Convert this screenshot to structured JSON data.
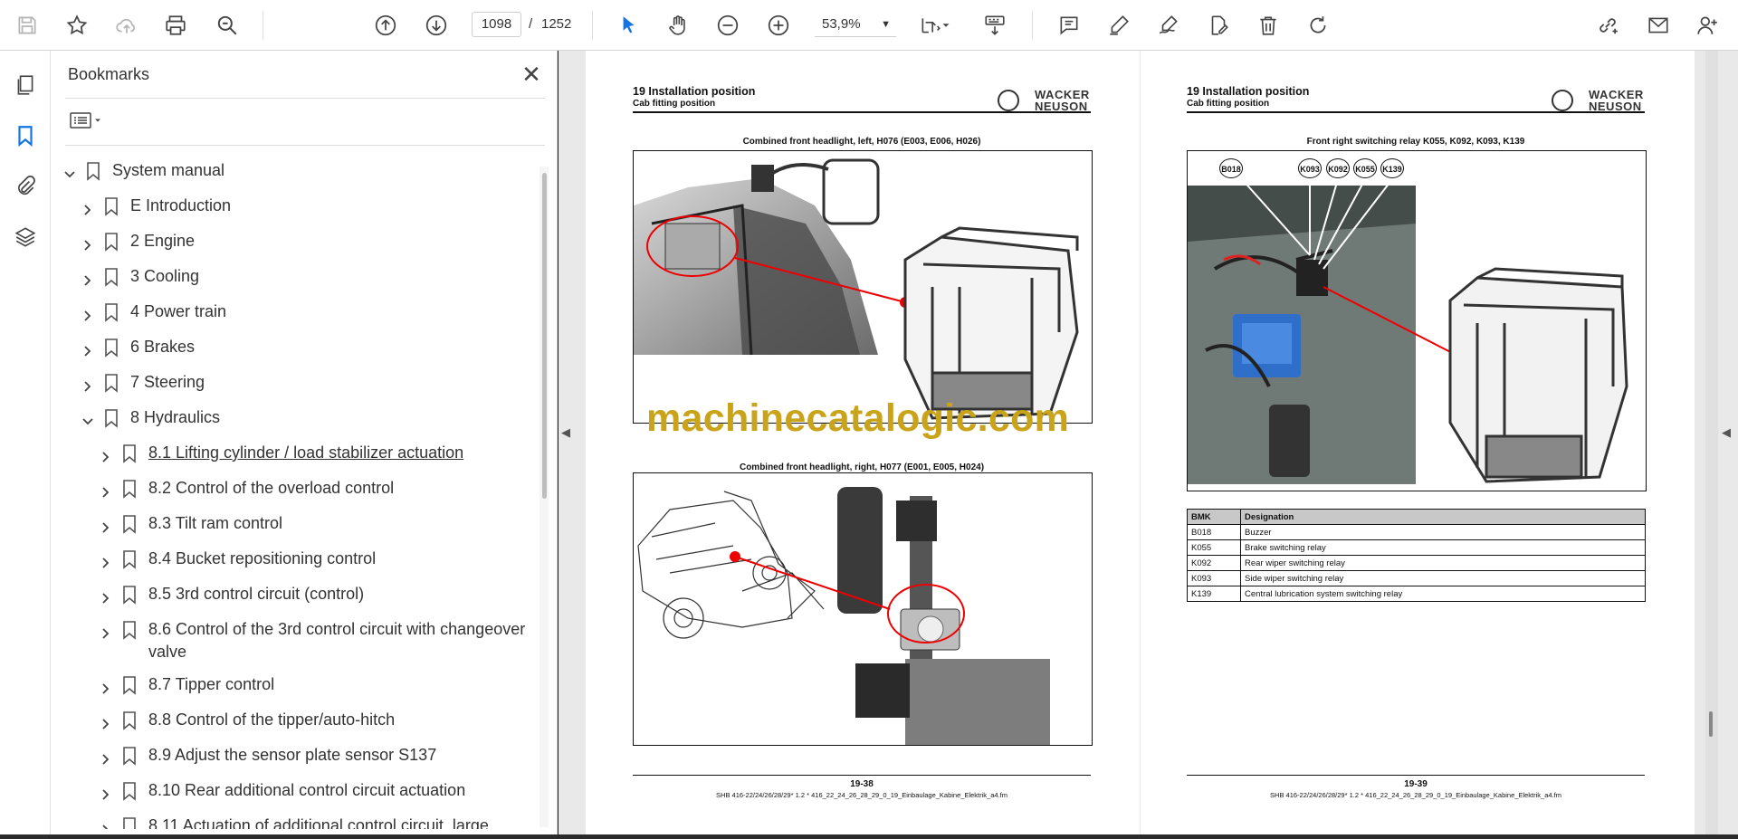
{
  "toolbar": {
    "current_page": "1098",
    "separator": "/",
    "total_pages": "1252",
    "zoom": "53,9%",
    "accent": "#1473e6"
  },
  "bookmarks_panel": {
    "title": "Bookmarks",
    "items": [
      {
        "label": "System manual",
        "level": 0,
        "expanded": true
      },
      {
        "label": "E Introduction",
        "level": 1,
        "expanded": false
      },
      {
        "label": "2 Engine",
        "level": 1,
        "expanded": false
      },
      {
        "label": "3 Cooling",
        "level": 1,
        "expanded": false
      },
      {
        "label": "4 Power train",
        "level": 1,
        "expanded": false
      },
      {
        "label": "6 Brakes",
        "level": 1,
        "expanded": false
      },
      {
        "label": "7 Steering",
        "level": 1,
        "expanded": false
      },
      {
        "label": "8 Hydraulics",
        "level": 1,
        "expanded": true
      },
      {
        "label": "8.1 Lifting cylinder / load stabilizer actuation",
        "level": 2,
        "expanded": false
      },
      {
        "label": "8.2 Control of the overload control",
        "level": 2,
        "expanded": false
      },
      {
        "label": "8.3 Tilt ram control",
        "level": 2,
        "expanded": false
      },
      {
        "label": "8.4 Bucket repositioning control",
        "level": 2,
        "expanded": false
      },
      {
        "label": "8.5 3rd control circuit (control)",
        "level": 2,
        "expanded": false
      },
      {
        "label": "8.6 Control of the 3rd control circuit with changeover",
        "label2": "valve",
        "level": 2,
        "expanded": false
      },
      {
        "label": "8.7 Tipper control",
        "level": 2,
        "expanded": false
      },
      {
        "label": "8.8 Control of the tipper/auto-hitch",
        "level": 2,
        "expanded": false
      },
      {
        "label": "8.9 Adjust the sensor plate sensor S137",
        "level": 2,
        "expanded": false
      },
      {
        "label": "8.10 Rear additional control circuit actuation",
        "level": 2,
        "expanded": false
      },
      {
        "label": "8.11 Actuation of additional control circuit, large,",
        "level": 2,
        "expanded": false
      }
    ]
  },
  "left_page": {
    "section": "19 Installation position",
    "subsection": "Cab fitting position",
    "brand_line1": "WACKER",
    "brand_line2": "NEUSON",
    "figure1_caption": "Combined front headlight, left, H076 (E003, E006, H026)",
    "figure2_caption": "Combined front headlight, right, H077 (E001, E005, H024)",
    "page_number": "19-38",
    "footer": "SHB 416-22/24/26/28/29* 1.2 * 416_22_24_26_28_29_0_19_Einbaulage_Kabine_Elektrik_a4.fm"
  },
  "right_page": {
    "section": "19 Installation position",
    "subsection": "Cab fitting position",
    "brand_line1": "WACKER",
    "brand_line2": "NEUSON",
    "figure_caption": "Front right switching relay K055, K092, K093, K139",
    "callouts": [
      "B018",
      "K093",
      "K092",
      "K055",
      "K139"
    ],
    "table": {
      "headers": [
        "BMK",
        "Designation"
      ],
      "rows": [
        [
          "B018",
          "Buzzer"
        ],
        [
          "K055",
          "Brake switching relay"
        ],
        [
          "K092",
          "Rear wiper switching relay"
        ],
        [
          "K093",
          "Side wiper switching relay"
        ],
        [
          "K139",
          "Central lubrication system switching relay"
        ]
      ]
    },
    "page_number": "19-39",
    "footer": "SHB 416-22/24/26/28/29* 1.2 * 416_22_24_26_28_29_0_19_Einbaulage_Kabine_Elektrik_a4.fm"
  },
  "watermark": "machinecatalogic.com"
}
